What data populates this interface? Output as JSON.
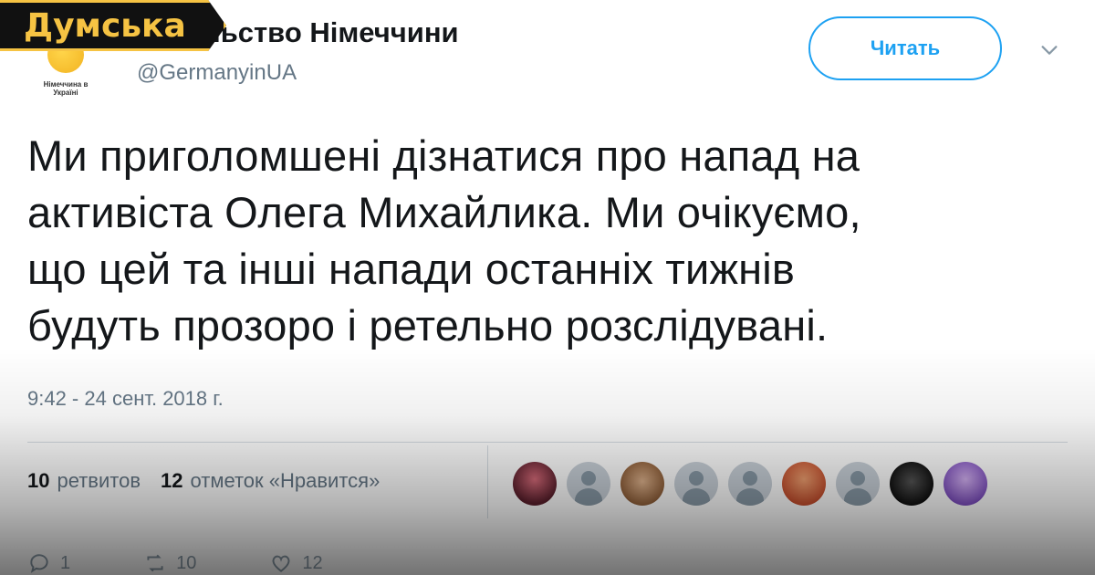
{
  "brand": {
    "label": "Думська"
  },
  "account": {
    "name": "льство Німеччини",
    "handle": "@GermanyinUA",
    "avatar_caption": "Німеччина в Україні"
  },
  "follow_button": {
    "label": "Читать"
  },
  "tweet": {
    "lines": [
      "Ми приголомшені дізнатися про напад на",
      "активіста Олега Михайлика. Ми очікуємо,",
      "що цей та інші напади останніх тижнів",
      "будуть прозоро і ретельно розслідувані."
    ],
    "timestamp": "9:42 - 24 сент. 2018 г."
  },
  "stats": {
    "retweets": {
      "count": "10",
      "label": "ретвитов"
    },
    "likes": {
      "count": "12",
      "label": "отметок «Нравится»"
    }
  },
  "likers": [
    "photo1",
    "default",
    "photo2",
    "default",
    "default",
    "photo3",
    "default",
    "photo4",
    "photo5"
  ],
  "actions": {
    "reply": "1",
    "retweet": "10",
    "like": "12"
  },
  "colors": {
    "accent": "#1da1f2",
    "muted": "#657786",
    "text": "#14171a",
    "brand_yellow": "#f6c343",
    "brand_black": "#111111"
  }
}
